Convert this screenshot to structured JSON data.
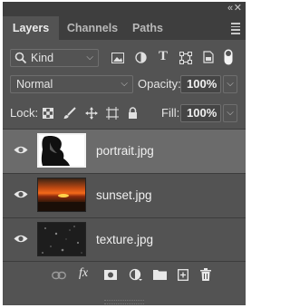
{
  "tabs": [
    {
      "label": "Layers",
      "active": true
    },
    {
      "label": "Channels",
      "active": false
    },
    {
      "label": "Paths",
      "active": false
    }
  ],
  "filter": {
    "kind_label": "Kind"
  },
  "blend": {
    "mode": "Normal",
    "opacity_label": "Opacity:",
    "opacity_value": "100%"
  },
  "lock": {
    "label": "Lock:",
    "fill_label": "Fill:",
    "fill_value": "100%"
  },
  "layers": [
    {
      "name": "portrait.jpg",
      "selected": true,
      "visible": true
    },
    {
      "name": "sunset.jpg",
      "selected": false,
      "visible": true
    },
    {
      "name": "texture.jpg",
      "selected": false,
      "visible": true
    }
  ],
  "bottom_buttons": [
    "link-layers-icon",
    "fx-icon",
    "add-mask-icon",
    "adjustment-layer-icon",
    "new-group-icon",
    "new-layer-icon",
    "trash-icon"
  ],
  "bottom": {
    "fx_label": "fx"
  },
  "colors": {
    "panel_bg": "#535353",
    "tabbar_bg": "#3e3e3e",
    "selected_row": "#6b6b6b"
  }
}
